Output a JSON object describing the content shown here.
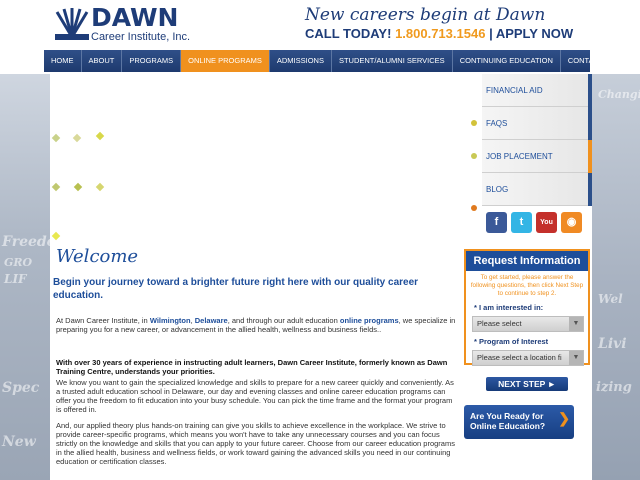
{
  "header": {
    "logo_name": "DAWN",
    "logo_sub": "Career Institute, Inc.",
    "tagline": "New careers begin at Dawn",
    "call_label": "CALL TODAY!",
    "phone": "1.800.713.1546",
    "apply_label": "| APPLY NOW"
  },
  "nav": [
    "HOME",
    "ABOUT",
    "PROGRAMS",
    "ONLINE PROGRAMS",
    "ADMISSIONS",
    "STUDENT/ALUMNI SERVICES",
    "CONTINUING EDUCATION",
    "CONTACT US"
  ],
  "nav_active": "ONLINE PROGRAMS",
  "sidebar": {
    "links": [
      "FINANCIAL AID",
      "FAQS",
      "JOB PLACEMENT",
      "BLOG"
    ],
    "social_icons": [
      "facebook-icon",
      "twitter-icon",
      "youtube-icon",
      "rss-icon"
    ]
  },
  "request": {
    "title": "Request Information",
    "intro": "To get started, please answer the following questions, then click Next Step to continue to step 2.",
    "interest_label": "* I am interested in:",
    "interest_value": "Please select",
    "program_label": "* Program of Interest",
    "program_value": "Please select a location fi",
    "next_label": "NEXT STEP ►"
  },
  "online_promo": {
    "line1": "Are You Ready for",
    "line2": "Online Education?"
  },
  "main": {
    "welcome": "Welcome",
    "intro_head": "Begin your journey toward a brighter future right here with our quality career education.",
    "p1_a": "At Dawn Career Institute, in",
    "p1_city": "Wilmington",
    "p1_comma": ", ",
    "p1_state": "Delaware",
    "p1_b": ", and through our adult education",
    "p1_link": "online programs",
    "p1_c": ", we specialize in preparing you for a new career, or advancement in the allied health, wellness and business fields..",
    "p2_bold": "With over 30 years of experience in instructing adult learners, Dawn Career Institute, formerly known as Dawn Training Centre, understands your priorities.",
    "p3": "We know you want to gain the specialized knowledge and skills to prepare for a new career quickly and conveniently. As a trusted adult education school in Delaware, our day and evening classes and online career education programs can offer you the freedom to fit education into your busy schedule. You can pick the time frame and the format your program is offered in.",
    "p4": "And, our applied theory plus hands-on training can give you skills to achieve excellence in the workplace. We strive to provide career-specific programs, which means you won't have to take any unnecessary courses and you can focus strictly on the knowledge and skills that you can apply to your future career. Choose from our career education programs in the allied health, business and wellness fields, or work toward gaining the advanced skills you need in our continuing education or certification classes."
  },
  "colors": {
    "brand_blue": "#1e3c78",
    "accent_orange": "#f0911e",
    "link_blue": "#1e4e9a"
  }
}
